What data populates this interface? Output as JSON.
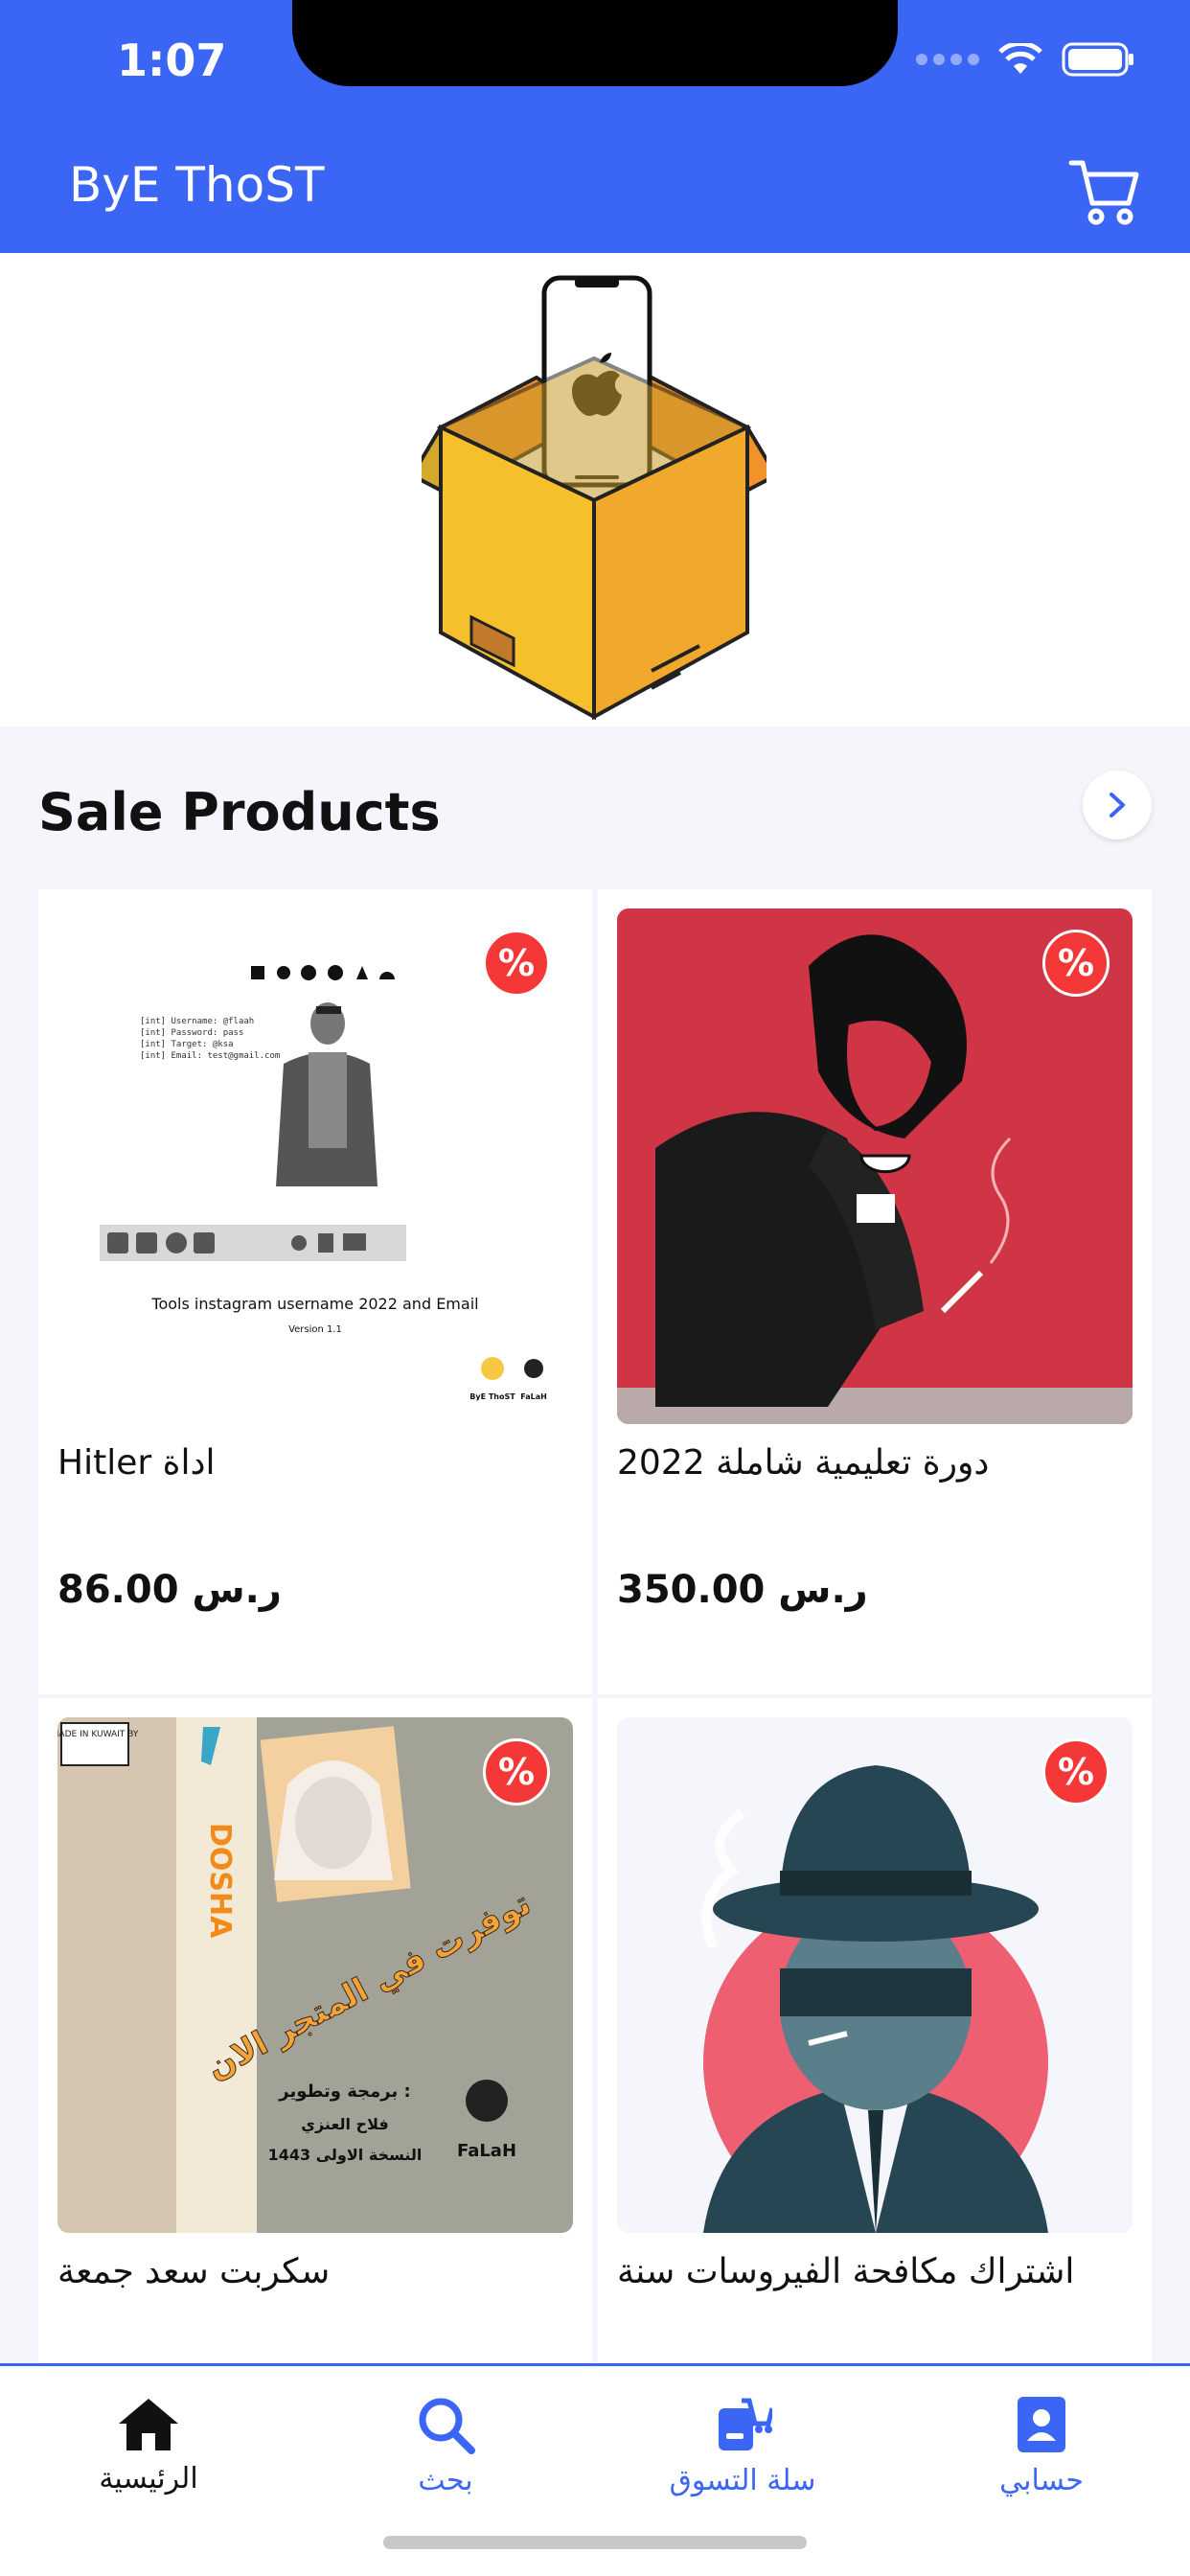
{
  "status": {
    "time": "1:07"
  },
  "header": {
    "title": "ByE ThoST"
  },
  "section": {
    "title": "Sale Products"
  },
  "products": [
    {
      "name": "Hitler اداة",
      "price": "86.00 ر.س",
      "badge": "%",
      "image_text": {
        "terminal": [
          "[int] Username: @flaah",
          "[int] Password: pass",
          "[int] Target: @ksa",
          "[int] Email: test@gmail.com"
        ],
        "caption": "Tools instagram username 2022 and Email",
        "version": "Version 1.1",
        "logo": "ByE ThoST",
        "logo2": "FaLaH"
      }
    },
    {
      "name": "دورة تعليمية شاملة 2022",
      "price": "350.00 ر.س",
      "badge": "%"
    },
    {
      "name": "سكربت سعد جمعة",
      "price": "",
      "badge": "%",
      "image_text": {
        "label": "MADE IN KUWAIT BY",
        "brand": "DOSHA",
        "headline": "توفرت في المتجر الان",
        "credit1": "برمجة وتطوير :",
        "credit2": "فلاح العنزي",
        "credit3": "النسخة الاولى 1443",
        "signature": "FaLaH"
      }
    },
    {
      "name": "اشتراك مكافحة الفيروسات سنة",
      "price": "",
      "badge": "%"
    }
  ],
  "tabs": [
    {
      "label": "الرئيسية",
      "icon": "home-icon",
      "active": true
    },
    {
      "label": "بحث",
      "icon": "search-icon"
    },
    {
      "label": "سلة التسوق",
      "icon": "cart-icon"
    },
    {
      "label": "حسابي",
      "icon": "account-icon"
    }
  ],
  "colors": {
    "primary": "#3b66f5",
    "badge": "#f43838",
    "background": "#f4f6fc"
  }
}
